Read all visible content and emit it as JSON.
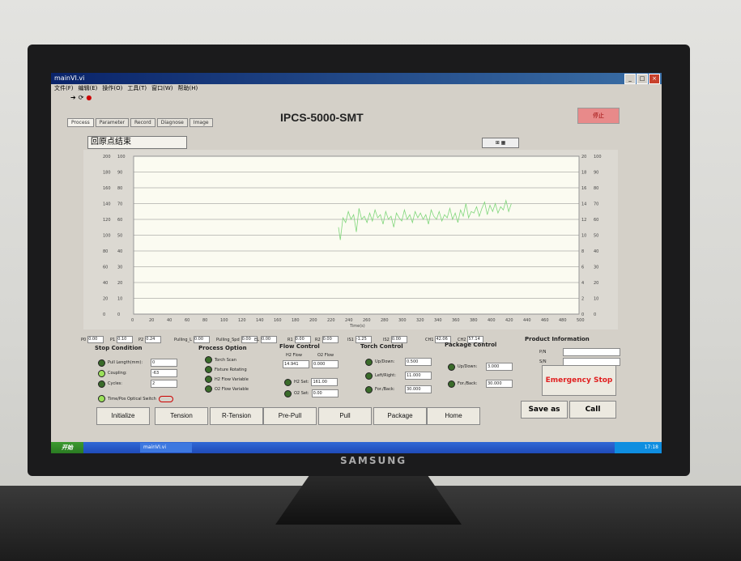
{
  "window": {
    "title": "mainVI.vi"
  },
  "menu": [
    "文件(F)",
    "编辑(E)",
    "操作(O)",
    "工具(T)",
    "窗口(W)",
    "帮助(H)"
  ],
  "toolbar": {
    "icons": [
      "run-arrow-icon",
      "run-continuous-icon",
      "stop-icon"
    ]
  },
  "tabs": [
    "Process",
    "Parameter",
    "Record",
    "Diagnose",
    "Image"
  ],
  "page_title": "IPCS-5000-SMT",
  "status_text": "回原点结束",
  "chart_data": {
    "type": "line",
    "xlabel": "Time(s)",
    "x_ticks": [
      0,
      20,
      40,
      60,
      80,
      100,
      120,
      140,
      160,
      180,
      200,
      220,
      240,
      260,
      280,
      300,
      320,
      340,
      360,
      380,
      400,
      420,
      440,
      460,
      480,
      500
    ],
    "y_ticks_left": [
      0,
      20,
      40,
      60,
      80,
      100,
      120,
      140,
      160,
      180,
      200
    ],
    "y_ticks_left2": [
      0,
      10,
      20,
      30,
      40,
      50,
      60,
      70,
      80,
      90,
      100
    ],
    "y_ticks_right": [
      0,
      2,
      4,
      6,
      8,
      10,
      12,
      14,
      16,
      18,
      20
    ],
    "y_ticks_right2": [
      0,
      10,
      20,
      30,
      40,
      50,
      60,
      70,
      80,
      90,
      100
    ],
    "series_color": "#7fd67a",
    "series": [
      {
        "x": [
          230,
          232,
          235,
          238,
          241,
          244,
          247,
          250,
          253,
          256,
          259,
          262,
          265,
          268,
          271,
          274,
          277,
          280,
          283,
          286,
          289,
          292,
          295,
          298,
          301,
          304,
          307,
          310,
          313,
          316,
          319,
          322,
          325,
          328,
          331,
          334,
          337,
          340,
          343,
          346,
          349,
          352,
          355,
          358,
          361,
          364,
          367,
          370,
          373,
          376,
          379,
          382,
          385,
          388,
          391,
          394,
          397,
          400,
          403,
          406,
          409,
          412,
          415,
          418,
          421,
          424
        ],
        "y": [
          55,
          47,
          61,
          58,
          65,
          60,
          63,
          52,
          67,
          60,
          62,
          58,
          64,
          59,
          66,
          61,
          63,
          57,
          65,
          60,
          62,
          55,
          64,
          61,
          59,
          66,
          60,
          63,
          58,
          65,
          61,
          64,
          60,
          63,
          57,
          66,
          62,
          60,
          65,
          59,
          63,
          61,
          67,
          60,
          64,
          58,
          66,
          62,
          70,
          61,
          65,
          64,
          68,
          62,
          67,
          71,
          63,
          69,
          65,
          70,
          64,
          68,
          66,
          72,
          65,
          70
        ]
      }
    ]
  },
  "sensors": [
    {
      "label": "P0",
      "value": "0.00"
    },
    {
      "label": "P1",
      "value": "0.10"
    },
    {
      "label": "P2",
      "value": "0.24"
    },
    {
      "label": "Pulling_L",
      "value": "0.00"
    },
    {
      "label": "Pulling_Spd",
      "value": "0.00"
    },
    {
      "label": "EL",
      "value": "0.00"
    },
    {
      "label": "R1",
      "value": "0.00"
    },
    {
      "label": "R2",
      "value": "0.00"
    },
    {
      "label": "IS1",
      "value": "-1.25"
    },
    {
      "label": "IS2",
      "value": "0.00"
    },
    {
      "label": "CH1",
      "value": "42.06"
    },
    {
      "label": "CH2",
      "value": "57.14"
    }
  ],
  "stop_condition": {
    "title": "Stop Condition",
    "rows": [
      {
        "label": "Pull Length(mm):",
        "value": "0",
        "on": false
      },
      {
        "label": "Coupling:",
        "value": "-63",
        "on": true
      },
      {
        "label": "Cycles:",
        "value": "2",
        "on": false
      }
    ],
    "switch": "Time/Pos  Optical Switch"
  },
  "process_option": {
    "title": "Process Option",
    "rows": [
      "Torch Scan",
      "Fixture Rotating",
      "H2 Flow Variable",
      "O2 Flow Variable"
    ]
  },
  "flow_control": {
    "title": "Flow Control",
    "h2_label": "H2 Flow",
    "o2_label": "O2 Flow",
    "h2_value": "14.941",
    "o2_value": "0.000",
    "h2_set_label": "H2 Set:",
    "h2_set": "161.00",
    "o2_set_label": "O2 Set:",
    "o2_set": "0.00"
  },
  "torch_control": {
    "title": "Torch Control",
    "rows": [
      {
        "label": "Up/Down:",
        "value": "0.500"
      },
      {
        "label": "Left/Right:",
        "value": "11.000"
      },
      {
        "label": "For./Back:",
        "value": "30.000"
      }
    ]
  },
  "package_control": {
    "title": "Package Control",
    "rows": [
      {
        "label": "Up/Down:",
        "value": "3.000"
      },
      {
        "label": "For./Back:",
        "value": "30.000"
      }
    ]
  },
  "product": {
    "title": "Product Information",
    "pn": "P/N",
    "sn": "S/N"
  },
  "buttons": {
    "emergency": "Emergency Stop",
    "save": "Save as",
    "call": "Call",
    "bottom": [
      "Initialize",
      "Tension",
      "R-Tension",
      "Pre-Pull",
      "Pull",
      "Package",
      "Home"
    ]
  },
  "taskbar": {
    "start": "开始",
    "task": "mainVI.vi",
    "clock": "17:18"
  },
  "monitor_brand": "SAMSUNG"
}
